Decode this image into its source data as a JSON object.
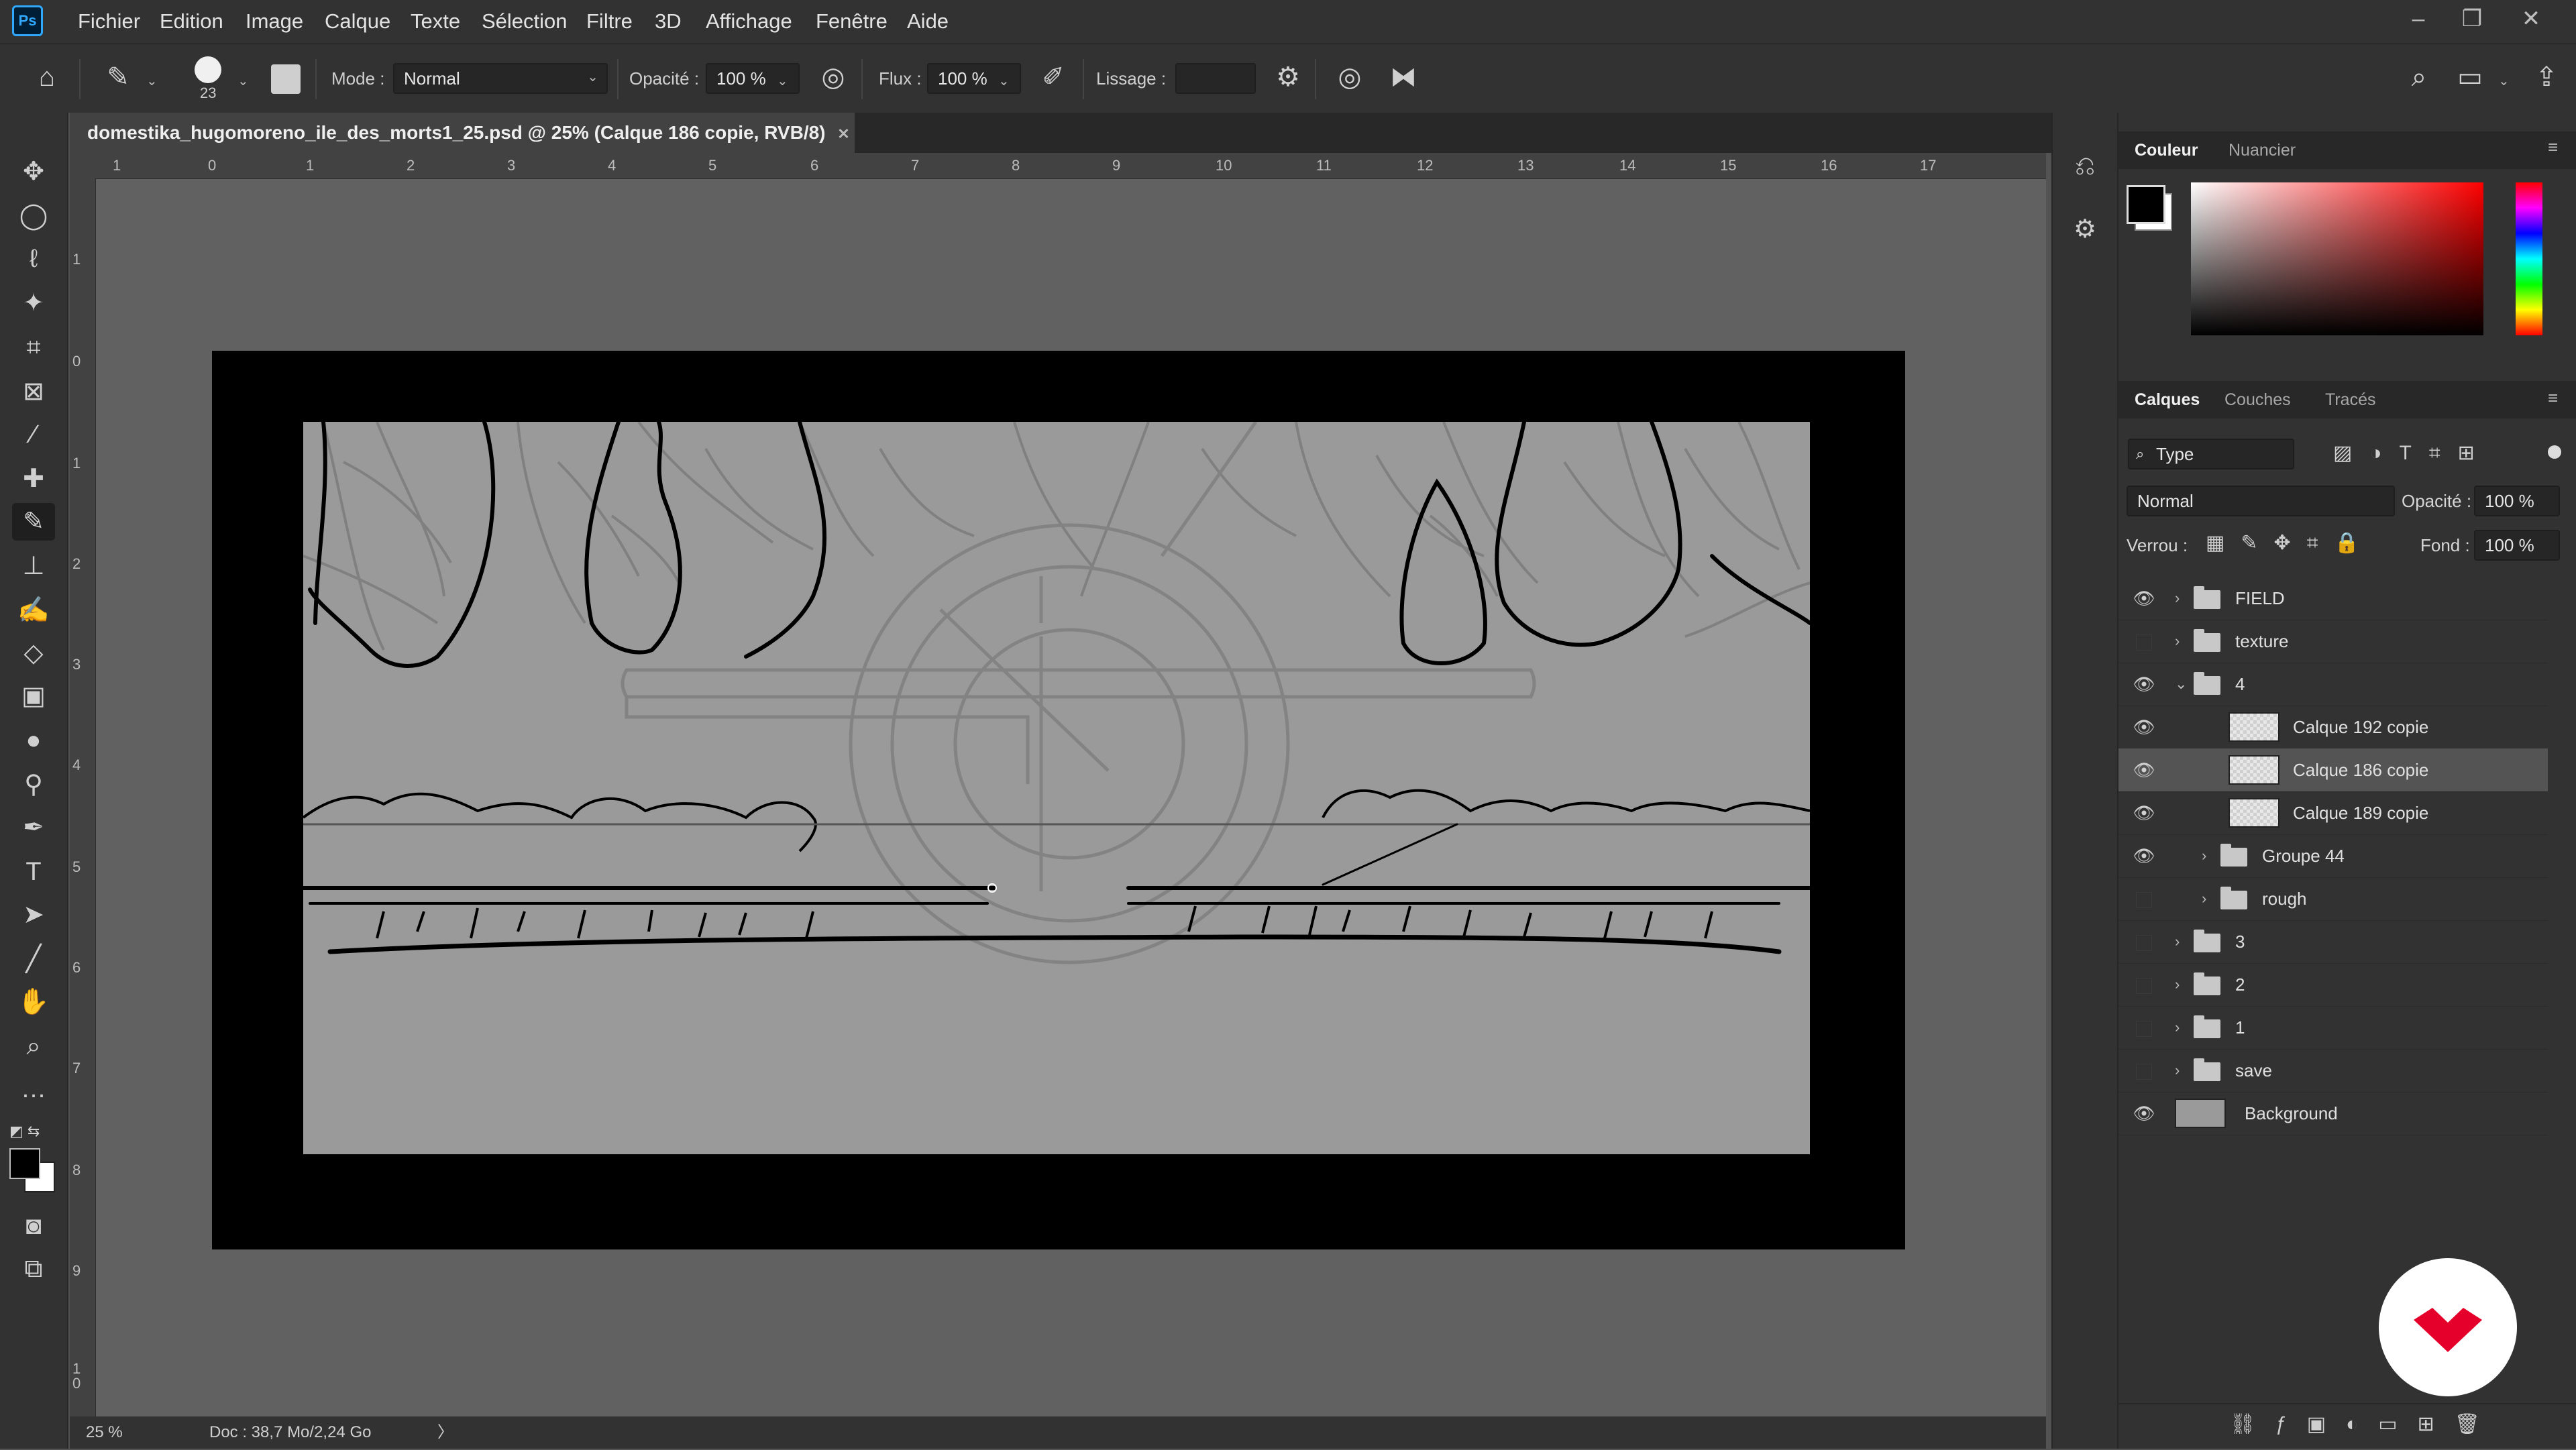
{
  "app": {
    "logo": "Ps",
    "accent": "#31a8ff"
  },
  "menu": [
    "Fichier",
    "Edition",
    "Image",
    "Calque",
    "Texte",
    "Sélection",
    "Filtre",
    "3D",
    "Affichage",
    "Fenêtre",
    "Aide"
  ],
  "window_controls": {
    "minimize": "–",
    "restore": "❐",
    "close": "✕"
  },
  "options": {
    "brush_size": "23",
    "mode_label": "Mode :",
    "mode_value": "Normal",
    "opacity_label": "Opacité :",
    "opacity_value": "100 %",
    "flow_label": "Flux :",
    "flow_value": "100 %",
    "smoothing_label": "Lissage :",
    "smoothing_value": ""
  },
  "document": {
    "tab_title": "domestika_hugomoreno_ile_des_morts1_25.psd @ 25% (Calque 186 copie, RVB/8)",
    "tab_close": "✕",
    "ruler_h": [
      "1",
      "0",
      "1",
      "2",
      "3",
      "4",
      "5",
      "6",
      "7",
      "8",
      "9",
      "10",
      "11",
      "12",
      "13",
      "14",
      "15",
      "16",
      "17"
    ],
    "ruler_v": [
      "1",
      "0",
      "1",
      "2",
      "3",
      "4",
      "5",
      "6",
      "7",
      "8",
      "9",
      "1\n0"
    ]
  },
  "status": {
    "zoom": "25 %",
    "doc_info": "Doc : 38,7 Mo/2,24 Go",
    "arrow": "〉"
  },
  "color_panel": {
    "tabs": [
      "Couleur",
      "Nuancier"
    ],
    "foreground": "#000000",
    "background": "#ffffff"
  },
  "layers_panel": {
    "tabs": [
      "Calques",
      "Couches",
      "Tracés"
    ],
    "filter_label": "Type",
    "blend_mode": "Normal",
    "opacity_label": "Opacité :",
    "opacity_value": "100 %",
    "lock_label": "Verrou :",
    "fill_label": "Fond :",
    "fill_value": "100 %",
    "layers": [
      {
        "name": "FIELD",
        "type": "group",
        "visible": true,
        "indent": 0,
        "expanded": false
      },
      {
        "name": "texture",
        "type": "group",
        "visible": false,
        "indent": 0,
        "expanded": false
      },
      {
        "name": "4",
        "type": "group",
        "visible": true,
        "indent": 0,
        "expanded": true
      },
      {
        "name": "Calque 192 copie",
        "type": "layer",
        "visible": true,
        "indent": 1
      },
      {
        "name": "Calque 186 copie",
        "type": "layer",
        "visible": true,
        "indent": 1,
        "selected": true
      },
      {
        "name": "Calque 189 copie",
        "type": "layer",
        "visible": true,
        "indent": 1
      },
      {
        "name": "Groupe 44",
        "type": "group",
        "visible": true,
        "indent": 1,
        "expanded": false
      },
      {
        "name": "rough",
        "type": "group",
        "visible": false,
        "indent": 1,
        "expanded": false
      },
      {
        "name": "3",
        "type": "group",
        "visible": false,
        "indent": 0,
        "expanded": false
      },
      {
        "name": "2",
        "type": "group",
        "visible": false,
        "indent": 0,
        "expanded": false
      },
      {
        "name": "1",
        "type": "group",
        "visible": false,
        "indent": 0,
        "expanded": false
      },
      {
        "name": "save",
        "type": "group",
        "visible": false,
        "indent": 0,
        "expanded": false
      },
      {
        "name": "Background",
        "type": "background",
        "visible": true,
        "indent": 0
      }
    ]
  }
}
